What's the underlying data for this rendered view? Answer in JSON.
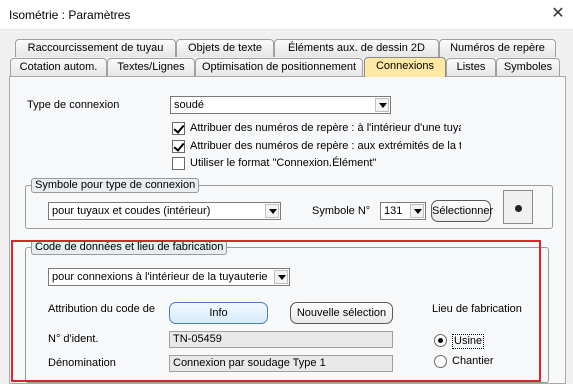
{
  "window": {
    "title": "Isométrie : Paramètres",
    "close_glyph": "✕"
  },
  "tabs_row1": [
    "Raccourcissement de tuyau",
    "Objets de texte",
    "Éléments aux. de dessin 2D",
    "Numéros de repère"
  ],
  "tabs_row2": [
    "Cotation autom.",
    "Textes/Lignes",
    "Optimisation de positionnement",
    "Connexions",
    "Listes",
    "Symboles"
  ],
  "active_tab": "Connexions",
  "connection": {
    "type_label": "Type de connexion",
    "type_value": "soudé",
    "checkboxes": [
      {
        "label": "Attribuer des numéros de repère : à l'intérieur d'une tuyauterie",
        "checked": true
      },
      {
        "label": "Attribuer des numéros de repère : aux extrémités de la tuyauterie",
        "checked": true
      },
      {
        "label": "Utiliser le format \"Connexion.Élément\"",
        "checked": false
      }
    ]
  },
  "symbol_group": {
    "title": "Symbole pour type de connexion",
    "combo_value": "pour tuyaux et coudes (intérieur)",
    "number_label": "Symbole N°",
    "number_value": "131",
    "select_button": "Sélectionner"
  },
  "fabrication_group": {
    "title": "Code de données et lieu de fabrication",
    "combo_value": "pour connexions à l'intérieur de la tuyauterie",
    "attribution_label": "Attribution du code de",
    "info_button": "Info",
    "new_selection_button": "Nouvelle sélection",
    "ident_label": "N° d'ident.",
    "ident_value": "TN-05459",
    "denomination_label": "Dénomination",
    "denomination_value": "Connexion par soudage Type 1",
    "place_label": "Lieu de fabrication",
    "places": [
      {
        "label": "Usine",
        "selected": true
      },
      {
        "label": "Chantier",
        "selected": false
      }
    ]
  }
}
